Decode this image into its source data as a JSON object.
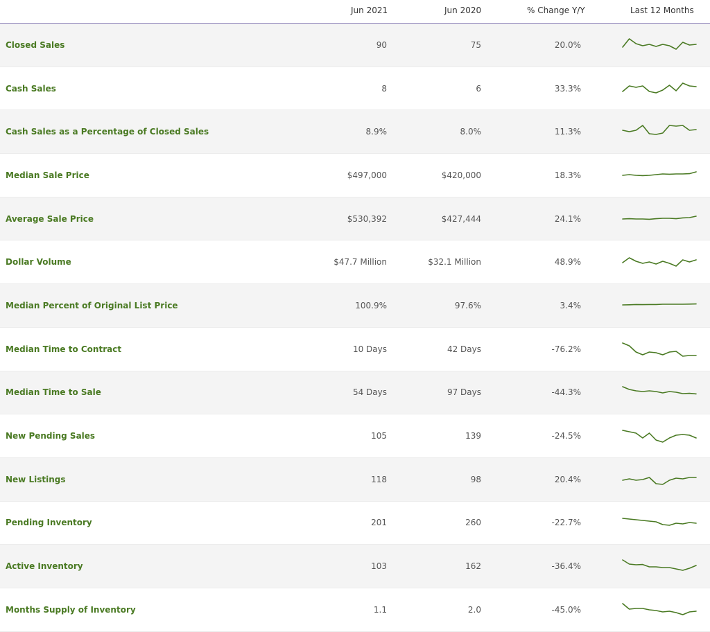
{
  "columns": {
    "label": "",
    "current": "Jun 2021",
    "prior": "Jun 2020",
    "change": "% Change Y/Y",
    "trend": "Last 12 Months"
  },
  "accent_color": "#4a7a23",
  "rows": [
    {
      "label": "Closed Sales",
      "current": "90",
      "prior": "75",
      "change": "20.0%",
      "trend": [
        0.35,
        0.95,
        0.6,
        0.45,
        0.55,
        0.4,
        0.55,
        0.45,
        0.2,
        0.7,
        0.5,
        0.55
      ]
    },
    {
      "label": "Cash Sales",
      "current": "8",
      "prior": "6",
      "change": "33.3%",
      "trend": [
        0.3,
        0.7,
        0.6,
        0.7,
        0.3,
        0.2,
        0.4,
        0.75,
        0.35,
        0.9,
        0.7,
        0.65
      ]
    },
    {
      "label": "Cash Sales as a Percentage of Closed Sales",
      "current": "8.9%",
      "prior": "8.0%",
      "change": "11.3%",
      "trend": [
        0.6,
        0.5,
        0.6,
        0.95,
        0.35,
        0.3,
        0.4,
        0.95,
        0.9,
        0.95,
        0.6,
        0.65
      ]
    },
    {
      "label": "Median Sale Price",
      "current": "$497,000",
      "prior": "$420,000",
      "change": "18.3%",
      "trend": [
        0.5,
        0.55,
        0.5,
        0.48,
        0.5,
        0.55,
        0.6,
        0.58,
        0.6,
        0.6,
        0.62,
        0.75
      ]
    },
    {
      "label": "Average Sale Price",
      "current": "$530,392",
      "prior": "$427,444",
      "change": "24.1%",
      "trend": [
        0.5,
        0.52,
        0.5,
        0.5,
        0.48,
        0.52,
        0.55,
        0.55,
        0.52,
        0.58,
        0.6,
        0.7
      ]
    },
    {
      "label": "Dollar Volume",
      "current": "$47.7 Million",
      "prior": "$32.1 Million",
      "change": "48.9%",
      "trend": [
        0.45,
        0.8,
        0.55,
        0.4,
        0.5,
        0.35,
        0.55,
        0.4,
        0.2,
        0.65,
        0.5,
        0.65
      ]
    },
    {
      "label": "Median Percent of Original List Price",
      "current": "100.9%",
      "prior": "97.6%",
      "change": "3.4%",
      "trend": [
        0.55,
        0.56,
        0.58,
        0.57,
        0.58,
        0.58,
        0.6,
        0.6,
        0.6,
        0.6,
        0.61,
        0.62
      ]
    },
    {
      "label": "Median Time to Contract",
      "current": "10 Days",
      "prior": "42 Days",
      "change": "-76.2%",
      "trend": [
        0.95,
        0.75,
        0.3,
        0.1,
        0.3,
        0.25,
        0.1,
        0.3,
        0.35,
        0.0,
        0.05,
        0.05
      ]
    },
    {
      "label": "Median Time to Sale",
      "current": "54 Days",
      "prior": "97 Days",
      "change": "-44.3%",
      "trend": [
        0.9,
        0.7,
        0.6,
        0.55,
        0.6,
        0.55,
        0.45,
        0.55,
        0.5,
        0.4,
        0.42,
        0.38
      ]
    },
    {
      "label": "New Pending Sales",
      "current": "105",
      "prior": "139",
      "change": "-24.5%",
      "trend": [
        0.9,
        0.8,
        0.7,
        0.35,
        0.7,
        0.2,
        0.05,
        0.35,
        0.55,
        0.6,
        0.55,
        0.35
      ]
    },
    {
      "label": "New Listings",
      "current": "118",
      "prior": "98",
      "change": "20.4%",
      "trend": [
        0.45,
        0.55,
        0.45,
        0.5,
        0.65,
        0.2,
        0.15,
        0.45,
        0.6,
        0.55,
        0.65,
        0.65
      ]
    },
    {
      "label": "Pending Inventory",
      "current": "201",
      "prior": "260",
      "change": "-22.7%",
      "trend": [
        0.8,
        0.75,
        0.7,
        0.65,
        0.6,
        0.55,
        0.35,
        0.3,
        0.45,
        0.4,
        0.5,
        0.45
      ]
    },
    {
      "label": "Active Inventory",
      "current": "103",
      "prior": "162",
      "change": "-36.4%",
      "trend": [
        0.95,
        0.65,
        0.6,
        0.62,
        0.45,
        0.45,
        0.4,
        0.4,
        0.3,
        0.2,
        0.35,
        0.55
      ]
    },
    {
      "label": "Months Supply of Inventory",
      "current": "1.1",
      "prior": "2.0",
      "change": "-45.0%",
      "trend": [
        0.95,
        0.55,
        0.6,
        0.6,
        0.5,
        0.45,
        0.35,
        0.4,
        0.3,
        0.15,
        0.35,
        0.4
      ]
    }
  ]
}
